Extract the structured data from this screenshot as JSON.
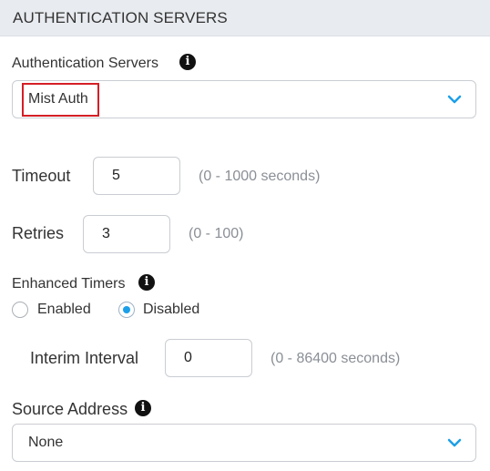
{
  "section": {
    "title": "AUTHENTICATION SERVERS"
  },
  "auth_servers": {
    "label": "Authentication Servers",
    "selected": "Mist Auth",
    "info_icon": "info-circle-icon",
    "dropdown_icon": "chevron-down-icon"
  },
  "timeout": {
    "label": "Timeout",
    "value": "5",
    "hint": "(0 - 1000 seconds)"
  },
  "retries": {
    "label": "Retries",
    "value": "3",
    "hint": "(0 - 100)"
  },
  "enhanced_timers": {
    "label": "Enhanced Timers",
    "options": [
      {
        "label": "Enabled",
        "selected": false
      },
      {
        "label": "Disabled",
        "selected": true
      }
    ]
  },
  "interim_interval": {
    "label": "Interim Interval",
    "value": "0",
    "hint": "(0 - 86400 seconds)"
  },
  "source_address": {
    "label": "Source Address",
    "selected": "None"
  },
  "colors": {
    "accent": "#1b9fe8",
    "highlight": "#d41f26",
    "header_bg": "#e8ebef"
  }
}
